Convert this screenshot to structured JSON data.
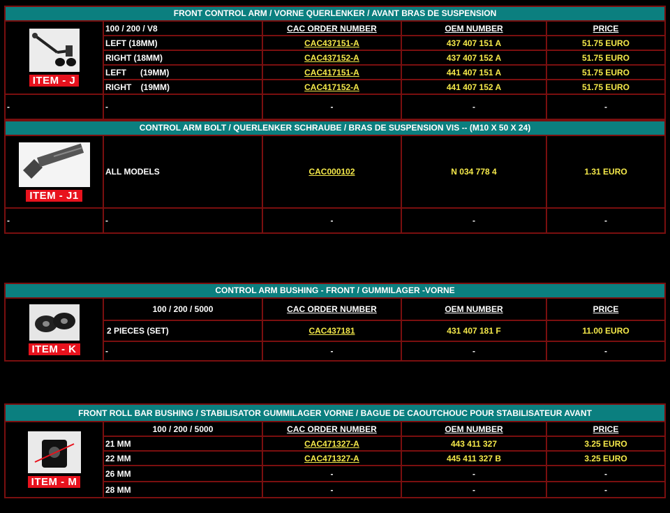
{
  "sections": [
    {
      "header": "FRONT CONTROL ARM   /    VORNE  QUERLENKER /     AVANT BRAS DE SUSPENSION",
      "item": "ITEM - J",
      "columns": [
        "100 / 200 / V8",
        "CAC ORDER NUMBER",
        "OEM NUMBER",
        "PRICE"
      ],
      "rows": [
        [
          "LEFT (18MM)",
          "CAC437151-A",
          "437 407 151 A",
          "51.75 EURO"
        ],
        [
          "RIGHT  (18MM)",
          "CAC437152-A",
          "437 407 152 A",
          "51.75 EURO"
        ],
        [
          "LEFT      (19MM)",
          "CAC417151-A",
          "441 407 151 A",
          "51.75 EURO"
        ],
        [
          "RIGHT    (19MM)",
          "CAC417152-A",
          "441 407 152 A",
          "51.75 EURO"
        ]
      ],
      "blank": [
        "-",
        "-",
        "-",
        "-",
        "-"
      ]
    },
    {
      "header": "CONTROL ARM  BOLT   /    QUERLENKER SCHRAUBE    /     BRAS DE SUSPENSION VIS    --  (M10 X 50 X 24)",
      "item": "ITEM - J1",
      "rows": [
        [
          "ALL MODELS",
          "CAC000102",
          "N 034 778 4",
          "1.31 EURO"
        ]
      ],
      "blank": [
        "-",
        "-",
        "-",
        "-",
        "-"
      ]
    },
    {
      "header": "CONTROL ARM BUSHING - FRONT / GUMMILAGER -VORNE",
      "item": "ITEM - K",
      "columns": [
        "100 / 200 / 5000",
        "CAC ORDER NUMBER",
        "OEM NUMBER",
        "PRICE"
      ],
      "rows": [
        [
          "2 PIECES (SET)",
          "CAC437181",
          "431 407 181 F",
          "11.00 EURO"
        ]
      ],
      "blank": [
        "-",
        "-",
        "-",
        "-"
      ]
    },
    {
      "header": "FRONT ROLL BAR BUSHING   /   STABILISATOR GUMMILAGER VORNE    /  BAGUE DE CAOUTCHOUC POUR STABILISATEUR AVANT",
      "item": "ITEM - M",
      "columns": [
        "100 / 200 / 5000",
        "CAC ORDER NUMBER",
        "OEM NUMBER",
        "PRICE"
      ],
      "rows": [
        [
          "21 MM",
          "CAC471327-A",
          "443 411 327",
          "3.25 EURO"
        ],
        [
          "22 MM",
          "CAC471327-A",
          "445 411 327 B",
          "3.25 EURO"
        ],
        [
          "26 MM",
          "-",
          "-",
          "-"
        ],
        [
          "28 MM",
          "-",
          "-",
          "-"
        ]
      ]
    }
  ],
  "colors": {
    "header": "#0b7f7f",
    "border": "#7a0f0f",
    "badge": "#e8121d",
    "accent": "#f5e94a"
  },
  "icons": [
    "control-arm-photo",
    "bolt-photo",
    "bushing-photo",
    "roll-bar-bushing-photo"
  ]
}
